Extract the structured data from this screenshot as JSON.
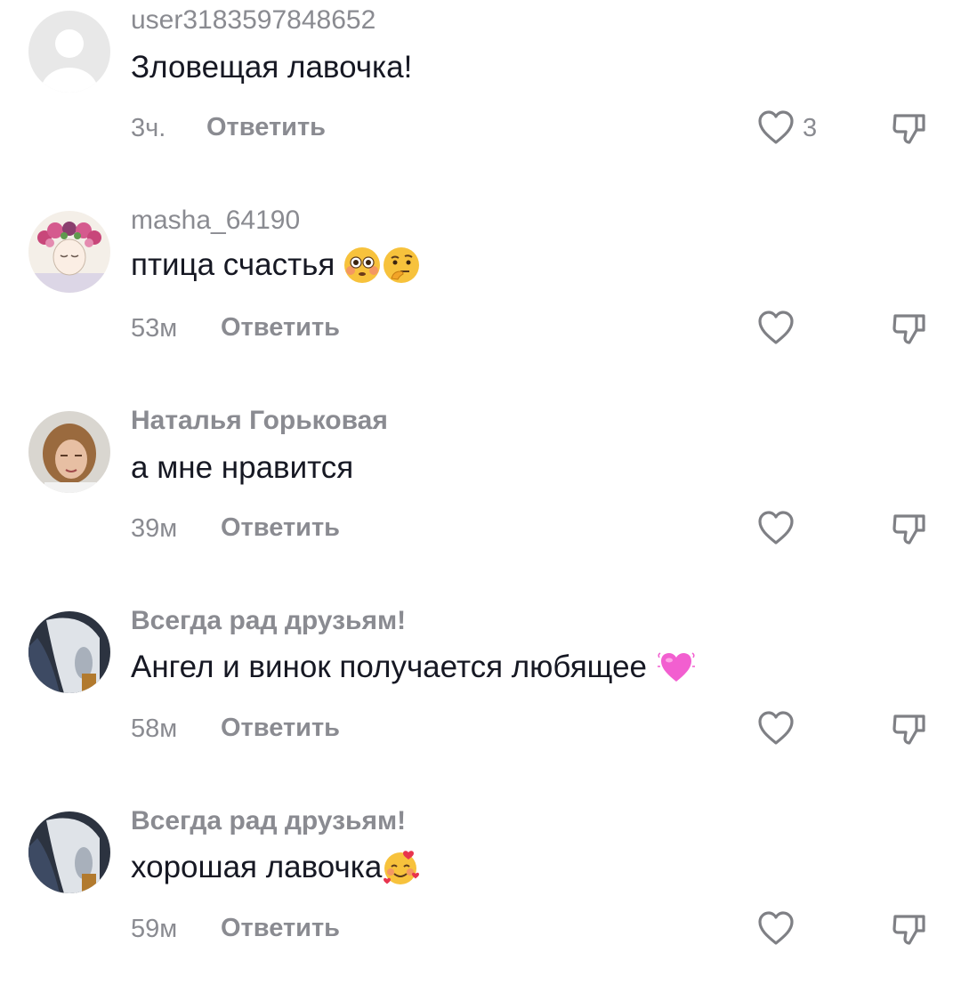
{
  "reply_label": "Ответить",
  "comments": [
    {
      "username": "user3183597848652",
      "text": "Зловещая лавочка!",
      "time": "3ч.",
      "likes": "3",
      "avatar": "default-avatar-icon"
    },
    {
      "username": "masha_64190",
      "text": "птица счастья",
      "time": "53м",
      "likes": "",
      "avatar": "flower-crown-girl-avatar",
      "emojis": [
        "flushed-face-emoji",
        "thinking-face-emoji"
      ]
    },
    {
      "username": "Наталья Горьковая",
      "text": "а мне нравится",
      "time": "39м",
      "likes": "",
      "avatar": "woman-photo-avatar"
    },
    {
      "username": "Всегда рад друзьям!",
      "text": "Ангел и винок получается любящее",
      "time": "58м",
      "likes": "",
      "avatar": "dog-photo-avatar",
      "emojis": [
        "pink-heart-emoji"
      ]
    },
    {
      "username": "Всегда рад друзьям!",
      "text": "хорошая лавочка",
      "time": "59м",
      "likes": "",
      "avatar": "dog-photo-avatar",
      "emojis": [
        "smiling-face-with-hearts-emoji"
      ]
    }
  ],
  "colors": {
    "secondary_text": "#8a8b91",
    "primary_text": "#161823",
    "icon_stroke": "#7f8085"
  }
}
